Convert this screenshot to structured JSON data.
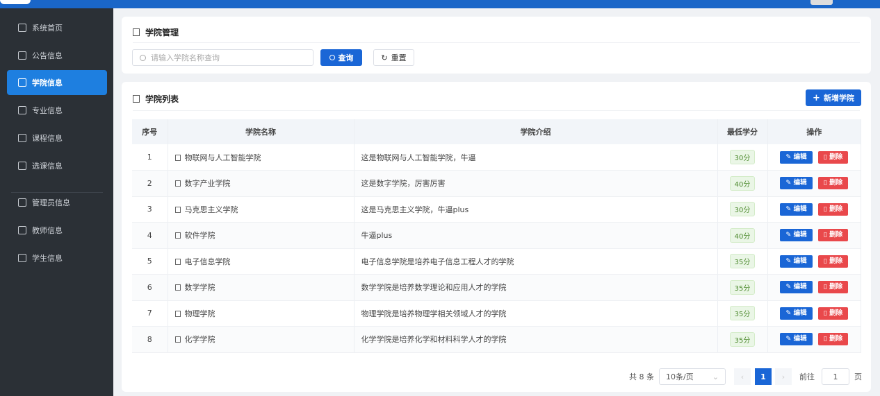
{
  "sidebar": {
    "items": [
      {
        "label": "系统首页"
      },
      {
        "label": "公告信息"
      },
      {
        "label": "学院信息"
      },
      {
        "label": "专业信息"
      },
      {
        "label": "课程信息"
      },
      {
        "label": "选课信息"
      },
      {
        "label": "管理员信息"
      },
      {
        "label": "教师信息"
      },
      {
        "label": "学生信息"
      }
    ]
  },
  "search_card": {
    "title": "学院管理",
    "placeholder": "请输入学院名称查询",
    "query_label": "查询",
    "reset_label": "重置"
  },
  "list_card": {
    "title": "学院列表",
    "add_label": "新增学院"
  },
  "table": {
    "headers": [
      "序号",
      "学院名称",
      "学院介绍",
      "最低学分",
      "操作"
    ],
    "rows": [
      {
        "no": "1",
        "name": "物联网与人工智能学院",
        "intro": "这是物联网与人工智能学院，牛逼",
        "credit": "30分"
      },
      {
        "no": "2",
        "name": "数字产业学院",
        "intro": "这是数字学院，厉害厉害",
        "credit": "40分"
      },
      {
        "no": "3",
        "name": "马克思主义学院",
        "intro": "这是马克思主义学院，牛逼plus",
        "credit": "30分"
      },
      {
        "no": "4",
        "name": "软件学院",
        "intro": "牛逼plus",
        "credit": "40分"
      },
      {
        "no": "5",
        "name": "电子信息学院",
        "intro": "电子信息学院是培养电子信息工程人才的学院",
        "credit": "35分"
      },
      {
        "no": "6",
        "name": "数学学院",
        "intro": "数学学院是培养数学理论和应用人才的学院",
        "credit": "35分"
      },
      {
        "no": "7",
        "name": "物理学院",
        "intro": "物理学院是培养物理学相关领域人才的学院",
        "credit": "35分"
      },
      {
        "no": "8",
        "name": "化学学院",
        "intro": "化学学院是培养化学和材料科学人才的学院",
        "credit": "35分"
      }
    ],
    "edit_label": "编辑",
    "delete_label": "删除"
  },
  "pagination": {
    "total": "共 8 条",
    "page_size": "10条/页",
    "current": "1",
    "goto_label": "前往",
    "goto_value": "1",
    "page_suffix": "页"
  }
}
